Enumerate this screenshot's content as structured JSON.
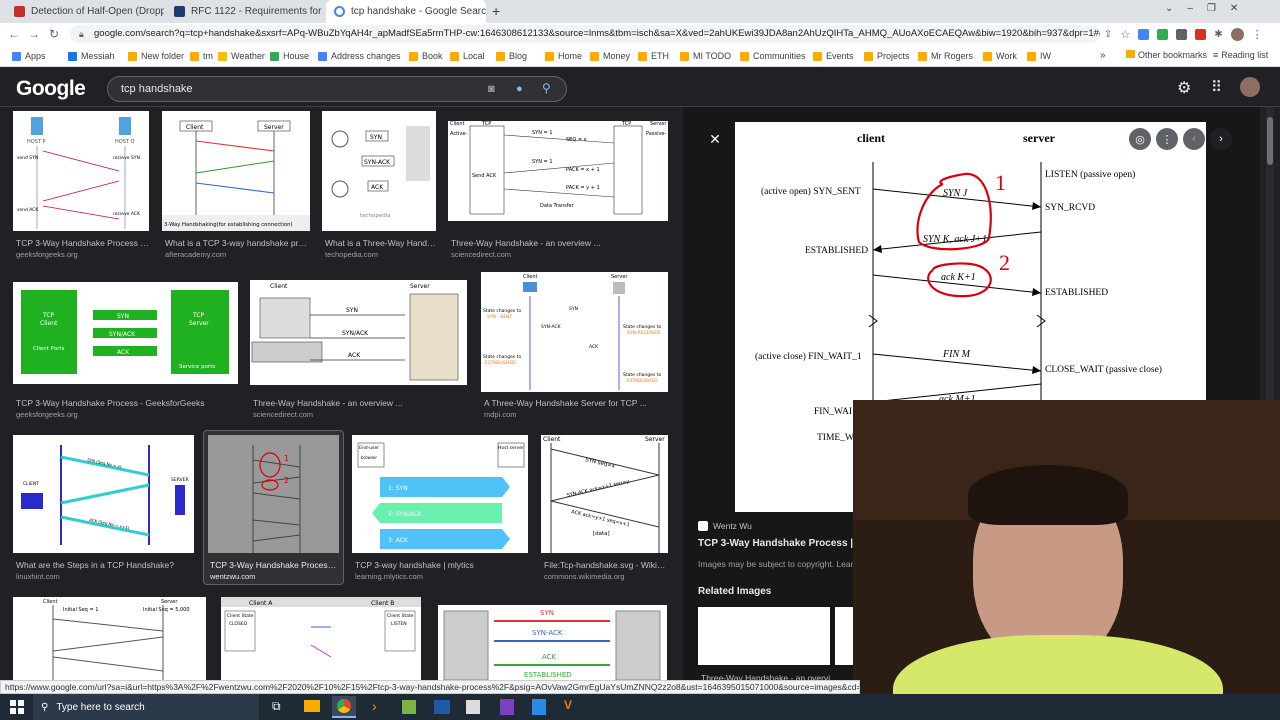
{
  "tabs": [
    {
      "title": "Detection of Half-Open (Droppe",
      "close": "×"
    },
    {
      "title": "RFC 1122 - Requirements for Inte",
      "close": "×"
    },
    {
      "title": "tcp handshake - Google Search",
      "close": "×"
    }
  ],
  "new_tab": "+",
  "address": "google.com/search?q=tcp+handshake&sxsrf=APq-WBuZbYqAH4r_apMadfSEa5rmTHP-cw:1646308612133&source=lnms&tbm=isch&sa=X&ved=2ahUKEwi39JDA8an2AhUzQIHTa_AHMQ_AUoAXoECAEQAw&biw=1920&bih=937&dpr=1#imgrc",
  "bookmarks": [
    {
      "label": "Apps",
      "color": "#4285f4"
    },
    {
      "label": "Messiah",
      "color": "#1a73e8"
    },
    {
      "label": "New folder",
      "color": "#f9ab00"
    },
    {
      "label": "tm",
      "color": "#f9ab00"
    },
    {
      "label": "Weather",
      "color": "#fbbc04"
    },
    {
      "label": "House",
      "color": "#34a853"
    },
    {
      "label": "Address changes",
      "color": "#4285f4"
    },
    {
      "label": "Book",
      "color": "#f9ab00"
    },
    {
      "label": "Local",
      "color": "#f9ab00"
    },
    {
      "label": "Blog",
      "color": "#f9ab00"
    },
    {
      "label": "Home",
      "color": "#f9ab00"
    },
    {
      "label": "Money",
      "color": "#f9ab00"
    },
    {
      "label": "ETH",
      "color": "#f9ab00"
    },
    {
      "label": "MI TODO",
      "color": "#f9ab00"
    },
    {
      "label": "Communities",
      "color": "#f9ab00"
    },
    {
      "label": "Events",
      "color": "#f9ab00"
    },
    {
      "label": "Projects",
      "color": "#f9ab00"
    },
    {
      "label": "Mr Rogers",
      "color": "#f9ab00"
    },
    {
      "label": "Work",
      "color": "#f9ab00"
    },
    {
      "label": "IW",
      "color": "#f9ab00"
    }
  ],
  "bookmarks_more": "»",
  "other_bookmarks": "Other bookmarks",
  "reading_list": "Reading list",
  "google_logo": "Google",
  "search_value": "tcp handshake",
  "results": [
    {
      "caption": "TCP 3-Way Handshake Process - ...",
      "source": "geeksforgeeks.org"
    },
    {
      "caption": "What is a TCP 3-way handshake proc...",
      "source": "afteracademy.com"
    },
    {
      "caption": "What is a Three-Way Handsh...",
      "source": "techopedia.com"
    },
    {
      "caption": "Three-Way Handshake - an overview ...",
      "source": "sciencedirect.com"
    },
    {
      "caption": "TCP 3-Way Handshake Process - GeeksforGeeks",
      "source": "geeksforgeeks.org"
    },
    {
      "caption": "Three-Way Handshake - an overview ...",
      "source": "sciencedirect.com"
    },
    {
      "caption": "A Three-Way Handshake Server for TCP ...",
      "source": "mdpi.com"
    },
    {
      "caption": "What are the Steps in a TCP Handshake?",
      "source": "linuxhint.com"
    },
    {
      "caption": "TCP 3-Way Handshake Process | ...",
      "source": "wentzwu.com"
    },
    {
      "caption": "TCP 3-way handshake | mlytics",
      "source": "learning.mlytics.com"
    },
    {
      "caption": "File:Tcp-handshake.svg - Wikim...",
      "source": "commons.wikimedia.org"
    }
  ],
  "thumb_text": {
    "gfg1_host": [
      "HOST P",
      "HOST Q"
    ],
    "gfg1_left": [
      "send SYN",
      "(seq=x)",
      "",
      "receive SYN",
      "(seq=x)",
      "ACK(x+1)",
      "",
      "send ACK",
      "(ack=y+1)"
    ],
    "gfg1_right": [
      "recieve SYN",
      "(seq=x)",
      "",
      "send SYN",
      "(seq=y)",
      "ACK(x+1)",
      "",
      "recieve ACK",
      "(ack=y+1)"
    ],
    "aa_client": "Client",
    "aa_server": "Server",
    "aa_bottom": "3-Way Handshaking(for establishing connection)",
    "tp": [
      "SYN",
      "SYN-ACK",
      "ACK",
      "techopedia"
    ],
    "sd1_left": [
      "Active-",
      "Open",
      "Send",
      "SEQ",
      "Send ACK",
      "Open-",
      "Success"
    ],
    "sd1_center": [
      "SYN = 1",
      "SEQ = x",
      "SYN = 1",
      "ACK = 1",
      "SEQ = y",
      "PACK = x + 1",
      "ACK = 1",
      "PACK = y + 1",
      "Data Transfer"
    ],
    "sd1_right": [
      "Passive-",
      "Open",
      "Open-",
      "Received",
      "Send",
      "SEQ"
    ],
    "sd1_heads": [
      "Client",
      "TCP",
      "TCP",
      "Server"
    ],
    "gfg2": [
      "TCP",
      "Client",
      "Client Ports",
      "SYN",
      "SYN/ACK",
      "ACK",
      "TCP",
      "Server",
      "Service ports"
    ],
    "sd2": [
      "Client",
      "Server",
      "SYN",
      "SYN/ACK",
      "ACK"
    ],
    "mdpi": [
      "Client",
      "Server",
      "State changes to",
      "SYN - SENT",
      "SYN",
      "seq: 100",
      "SYN-ACK",
      "seq: 200",
      "ack: 101",
      "State changes to",
      "SYN-RECEIVED",
      "State changes to",
      "ESTABLISHED",
      "ACK",
      "seq: 101",
      "ack: 201",
      "State changes to",
      "ESTABLISHED"
    ],
    "lh": [
      "CLIENT",
      "SERVER",
      "SYN (Seq No = x)",
      "SYN, ACK (Seq No = y, ACK = x+1)",
      "ACK (Seq No = x+1)"
    ],
    "ml": [
      "End-user",
      "browser",
      "Host server",
      "1: SYN",
      "2: SYN/ACK",
      "3: ACK"
    ],
    "wk": [
      "Client",
      "Server",
      "SYN seq=x",
      "SYN-ACK ack=x+1 seq=y",
      "ACK ack=y+1 seq=x+1",
      "[data]"
    ],
    "r4a": [
      "Client",
      "Server",
      "Initial Seq = 1",
      "Initial Seq = 5,000"
    ],
    "r4b": [
      "Client A",
      "Client B",
      "Client State",
      "CLOSED",
      "Client State",
      "LISTEN"
    ],
    "r4c": [
      "SYN",
      "SYN-ACK",
      "ACK",
      "ESTABLISHED"
    ]
  },
  "viewer": {
    "client": "client",
    "server": "server",
    "left_labels": [
      "(active open)  SYN_SENT",
      "ESTABLISHED",
      "(active close)  FIN_WAIT_1",
      "FIN_WAI",
      "TIME_W"
    ],
    "right_labels": [
      "LISTEN  (passive open)",
      "SYN_RCVD",
      "ESTABLISHED",
      "CLOSE_WAIT  (passive close)"
    ],
    "msgs": [
      "SYN J",
      "SYN K, ack J+1",
      "ack K+1",
      "FIN M",
      "ack M+1"
    ],
    "notes": [
      "1",
      "2"
    ],
    "site": "Wentz Wu",
    "title": "TCP 3-Way Handshake Process | We",
    "copyright": "Images may be subject to copyright. Learn",
    "related": "Related Images",
    "related_cap": "Three-Way Handshake - an overvi"
  },
  "status_url": "https://www.google.com/url?sa=i&url=https%3A%2F%2Fwentzwu.com%2F2020%2F10%2F15%2Ftcp-3-way-handshake-process%2F&psig=AOvVaw2GmrEgUaYsUmZNNQ2z2o8&ust=1646395015071000&source=images&cd=vfe&ved=0CA",
  "taskbar_search": "Type here to search"
}
